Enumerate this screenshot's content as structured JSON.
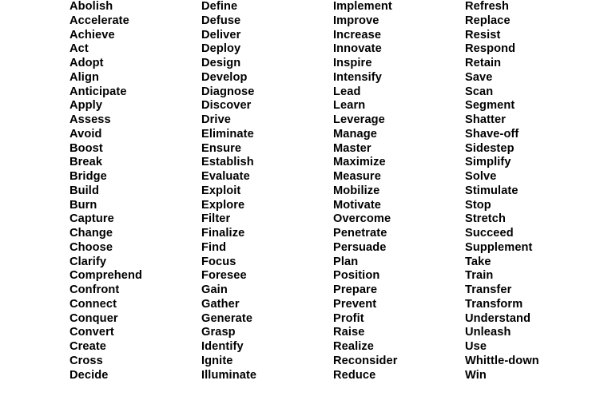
{
  "page": {
    "background_color": "#ffffff",
    "text_color": "#000000",
    "layout": "four-column-word-list",
    "column_count": 4,
    "rows_per_column": 28,
    "total_words": 112
  },
  "columns": [
    {
      "name": "column-1",
      "items": [
        "Abolish",
        "Accelerate",
        "Achieve",
        "Act",
        "Adopt",
        "Align",
        "Anticipate",
        "Apply",
        "Assess",
        "Avoid",
        "Boost",
        "Break",
        "Bridge",
        "Build",
        "Burn",
        "Capture",
        "Change",
        "Choose",
        "Clarify",
        "Comprehend",
        "Confront",
        "Connect",
        "Conquer",
        "Convert",
        "Create",
        "Cross",
        "Decide"
      ]
    },
    {
      "name": "column-2",
      "items": [
        "Define",
        "Defuse",
        "Deliver",
        "Deploy",
        "Design",
        "Develop",
        "Diagnose",
        "Discover",
        "Drive",
        "Eliminate",
        "Ensure",
        "Establish",
        "Evaluate",
        "Exploit",
        "Explore",
        "Filter",
        "Finalize",
        "Find",
        "Focus",
        "Foresee",
        "Gain",
        "Gather",
        "Generate",
        "Grasp",
        "Identify",
        "Ignite",
        "Illuminate"
      ]
    },
    {
      "name": "column-3",
      "items": [
        "Implement",
        "Improve",
        "Increase",
        "Innovate",
        "Inspire",
        "Intensify",
        "Lead",
        "Learn",
        "Leverage",
        "Manage",
        "Master",
        "Maximize",
        "Measure",
        "Mobilize",
        "Motivate",
        "Overcome",
        "Penetrate",
        "Persuade",
        "Plan",
        "Position",
        "Prepare",
        "Prevent",
        "Profit",
        "Raise",
        "Realize",
        "Reconsider",
        "Reduce"
      ]
    },
    {
      "name": "column-4",
      "items": [
        "Refresh",
        "Replace",
        "Resist",
        "Respond",
        "Retain",
        "Save",
        "Scan",
        "Segment",
        "Shatter",
        "Shave-off",
        "Sidestep",
        "Simplify",
        "Solve",
        "Stimulate",
        "Stop",
        "Stretch",
        "Succeed",
        "Supplement",
        "Take",
        "Train",
        "Transfer",
        "Transform",
        "Understand",
        "Unleash",
        "Use",
        "Whittle-down",
        "Win"
      ]
    }
  ]
}
